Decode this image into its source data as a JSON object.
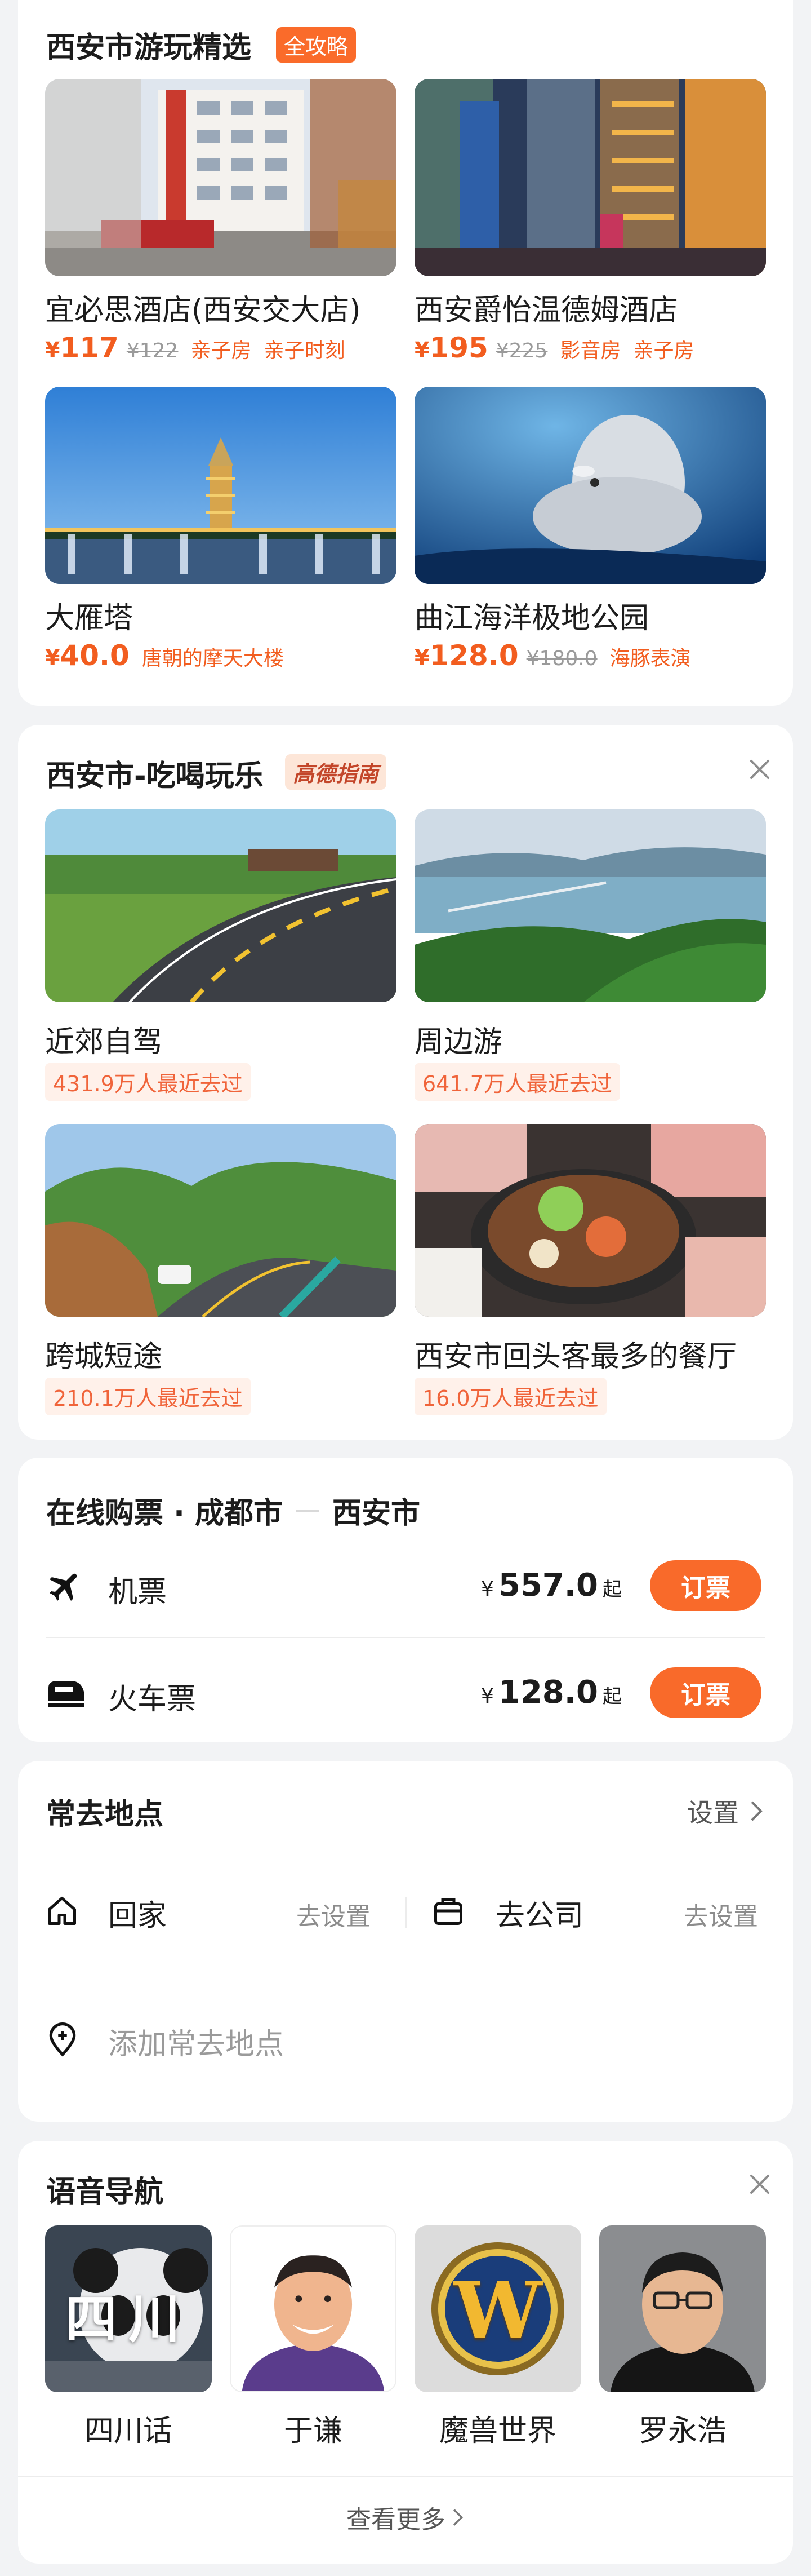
{
  "picks": {
    "title": "西安市游玩精选",
    "badge": "全攻略",
    "items": [
      {
        "name": "宜必思酒店(西安交大店)",
        "price_symbol": "¥",
        "price": "117",
        "old_price": "¥122",
        "tags": [
          "亲子房",
          "亲子时刻"
        ]
      },
      {
        "name": "西安爵怡温德姆酒店",
        "price_symbol": "¥",
        "price": "195",
        "old_price": "¥225",
        "tags": [
          "影音房",
          "亲子房"
        ]
      },
      {
        "name": "大雁塔",
        "price_symbol": "¥",
        "price": "40.0",
        "old_price": "",
        "tags": [
          "唐朝的摩天大楼"
        ]
      },
      {
        "name": "曲江海洋极地公园",
        "price_symbol": "¥",
        "price": "128.0",
        "old_price": "¥180.0",
        "tags": [
          "海豚表演"
        ]
      }
    ]
  },
  "eat": {
    "title": "西安市-吃喝玩乐",
    "badge": "高德指南",
    "items": [
      {
        "name": "近郊自驾",
        "visits": "431.9万人最近去过"
      },
      {
        "name": "周边游",
        "visits": "641.7万人最近去过"
      },
      {
        "name": "跨城短途",
        "visits": "210.1万人最近去过"
      },
      {
        "name": "西安市回头客最多的餐厅",
        "visits": "16.0万人最近去过"
      }
    ]
  },
  "tickets": {
    "title_prefix": "在线购票 · 成都市",
    "title_dest": "西安市",
    "rows": [
      {
        "label": "机票",
        "yen": "¥",
        "price": "557.0",
        "suffix": "起",
        "button": "订票"
      },
      {
        "label": "火车票",
        "yen": "¥",
        "price": "128.0",
        "suffix": "起",
        "button": "订票"
      }
    ]
  },
  "places": {
    "title": "常去地点",
    "settings": "设置",
    "home": {
      "label": "回家",
      "action": "去设置"
    },
    "work": {
      "label": "去公司",
      "action": "去设置"
    },
    "add": "添加常去地点"
  },
  "voice": {
    "title": "语音导航",
    "items": [
      {
        "name": "四川话",
        "overlay": "四川"
      },
      {
        "name": "于谦"
      },
      {
        "name": "魔兽世界",
        "overlay": "W"
      },
      {
        "name": "罗永浩"
      }
    ],
    "more": "查看更多"
  },
  "colors": {
    "accent": "#f96a2a",
    "price": "#f25d1f",
    "background": "#f2f3f5"
  }
}
